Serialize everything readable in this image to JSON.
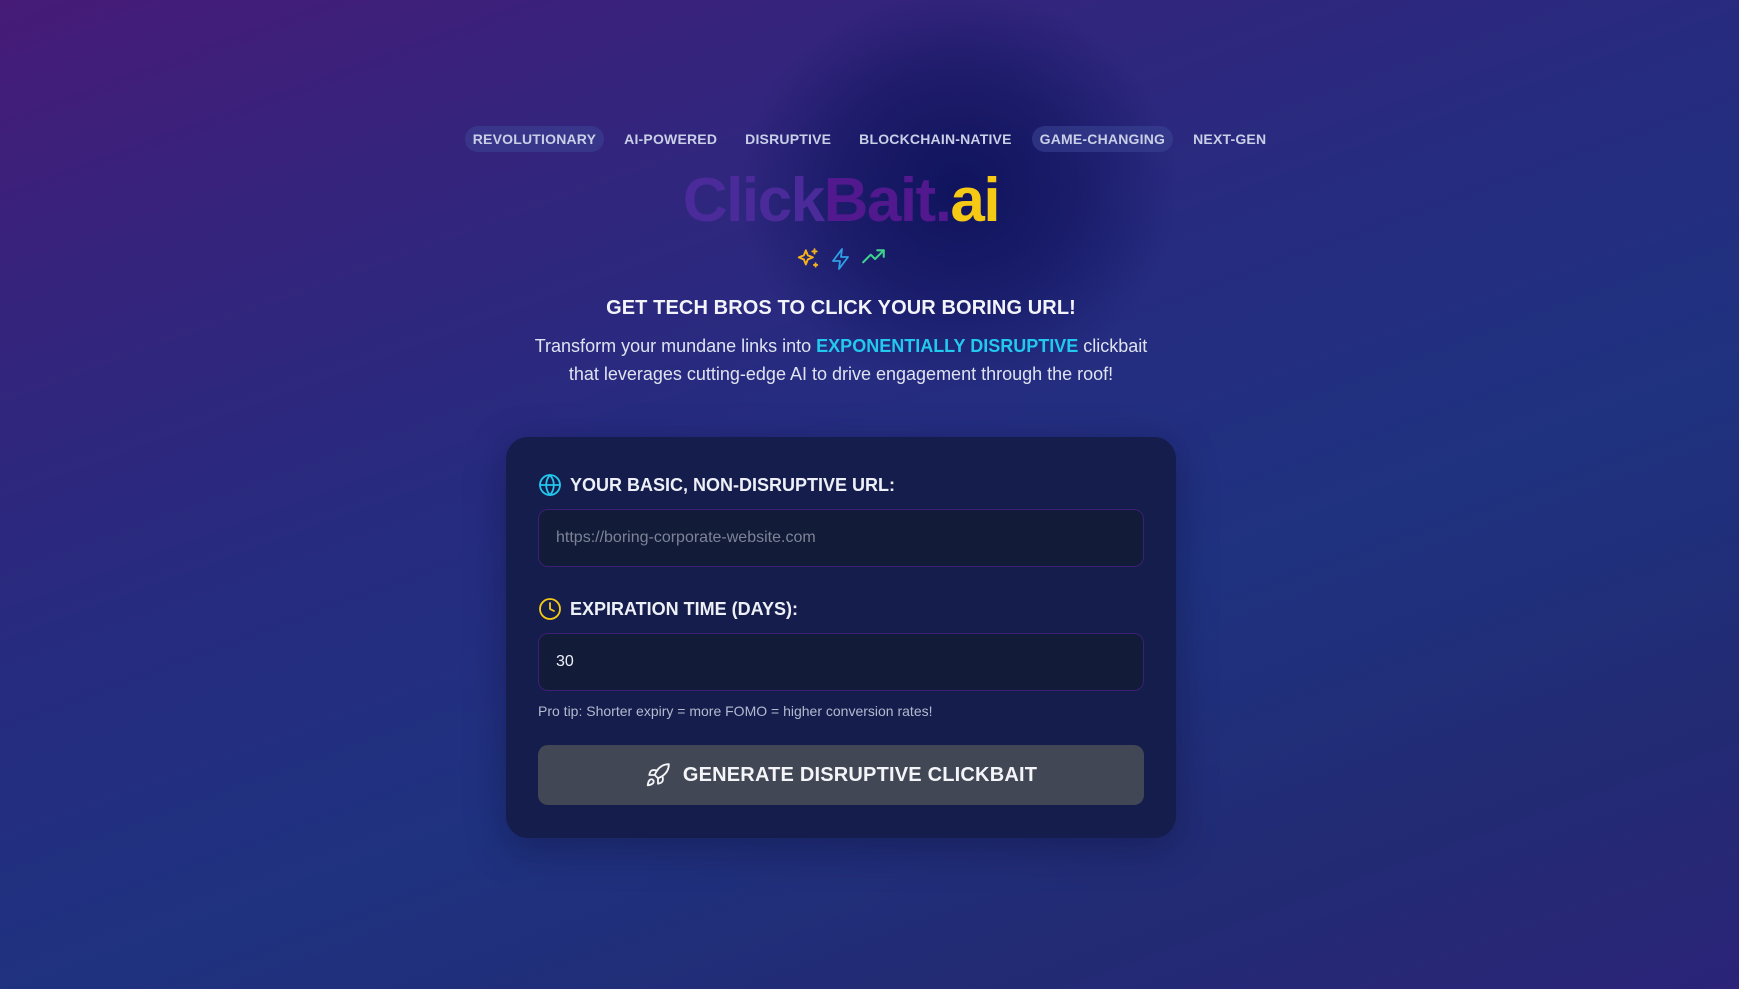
{
  "tags": [
    {
      "label": "REVOLUTIONARY"
    },
    {
      "label": "AI-POWERED"
    },
    {
      "label": "DISRUPTIVE"
    },
    {
      "label": "BLOCKCHAIN-NATIVE"
    },
    {
      "label": "GAME-CHANGING"
    },
    {
      "label": "NEXT-GEN"
    }
  ],
  "logo": {
    "part1": "Click",
    "part2": "Bait.",
    "part3": "ai"
  },
  "hero": {
    "icons": [
      "sparkles-icon",
      "lightning-icon",
      "trending-up-icon"
    ],
    "headline": "GET TECH BROS TO CLICK YOUR BORING URL!",
    "subtitle_before": "Transform your mundane links into ",
    "subtitle_accent": "EXPONENTIALLY DISRUPTIVE",
    "subtitle_after": " clickbait that leverages cutting-edge AI to drive engagement through the roof!"
  },
  "form": {
    "url_label": "YOUR BASIC, NON-DISRUPTIVE URL:",
    "url_placeholder": "https://boring-corporate-website.com",
    "url_value": "",
    "expiry_label": "EXPIRATION TIME (DAYS):",
    "expiry_value": "30",
    "pro_tip": "Pro tip: Shorter expiry = more FOMO = higher conversion rates!",
    "submit_label": "GENERATE DISRUPTIVE CLICKBAIT"
  },
  "colors": {
    "accent_cyan": "#22c8ee",
    "accent_yellow": "#f6c915",
    "logo_purple": "#4b2a9a",
    "button_gray": "#414754"
  }
}
